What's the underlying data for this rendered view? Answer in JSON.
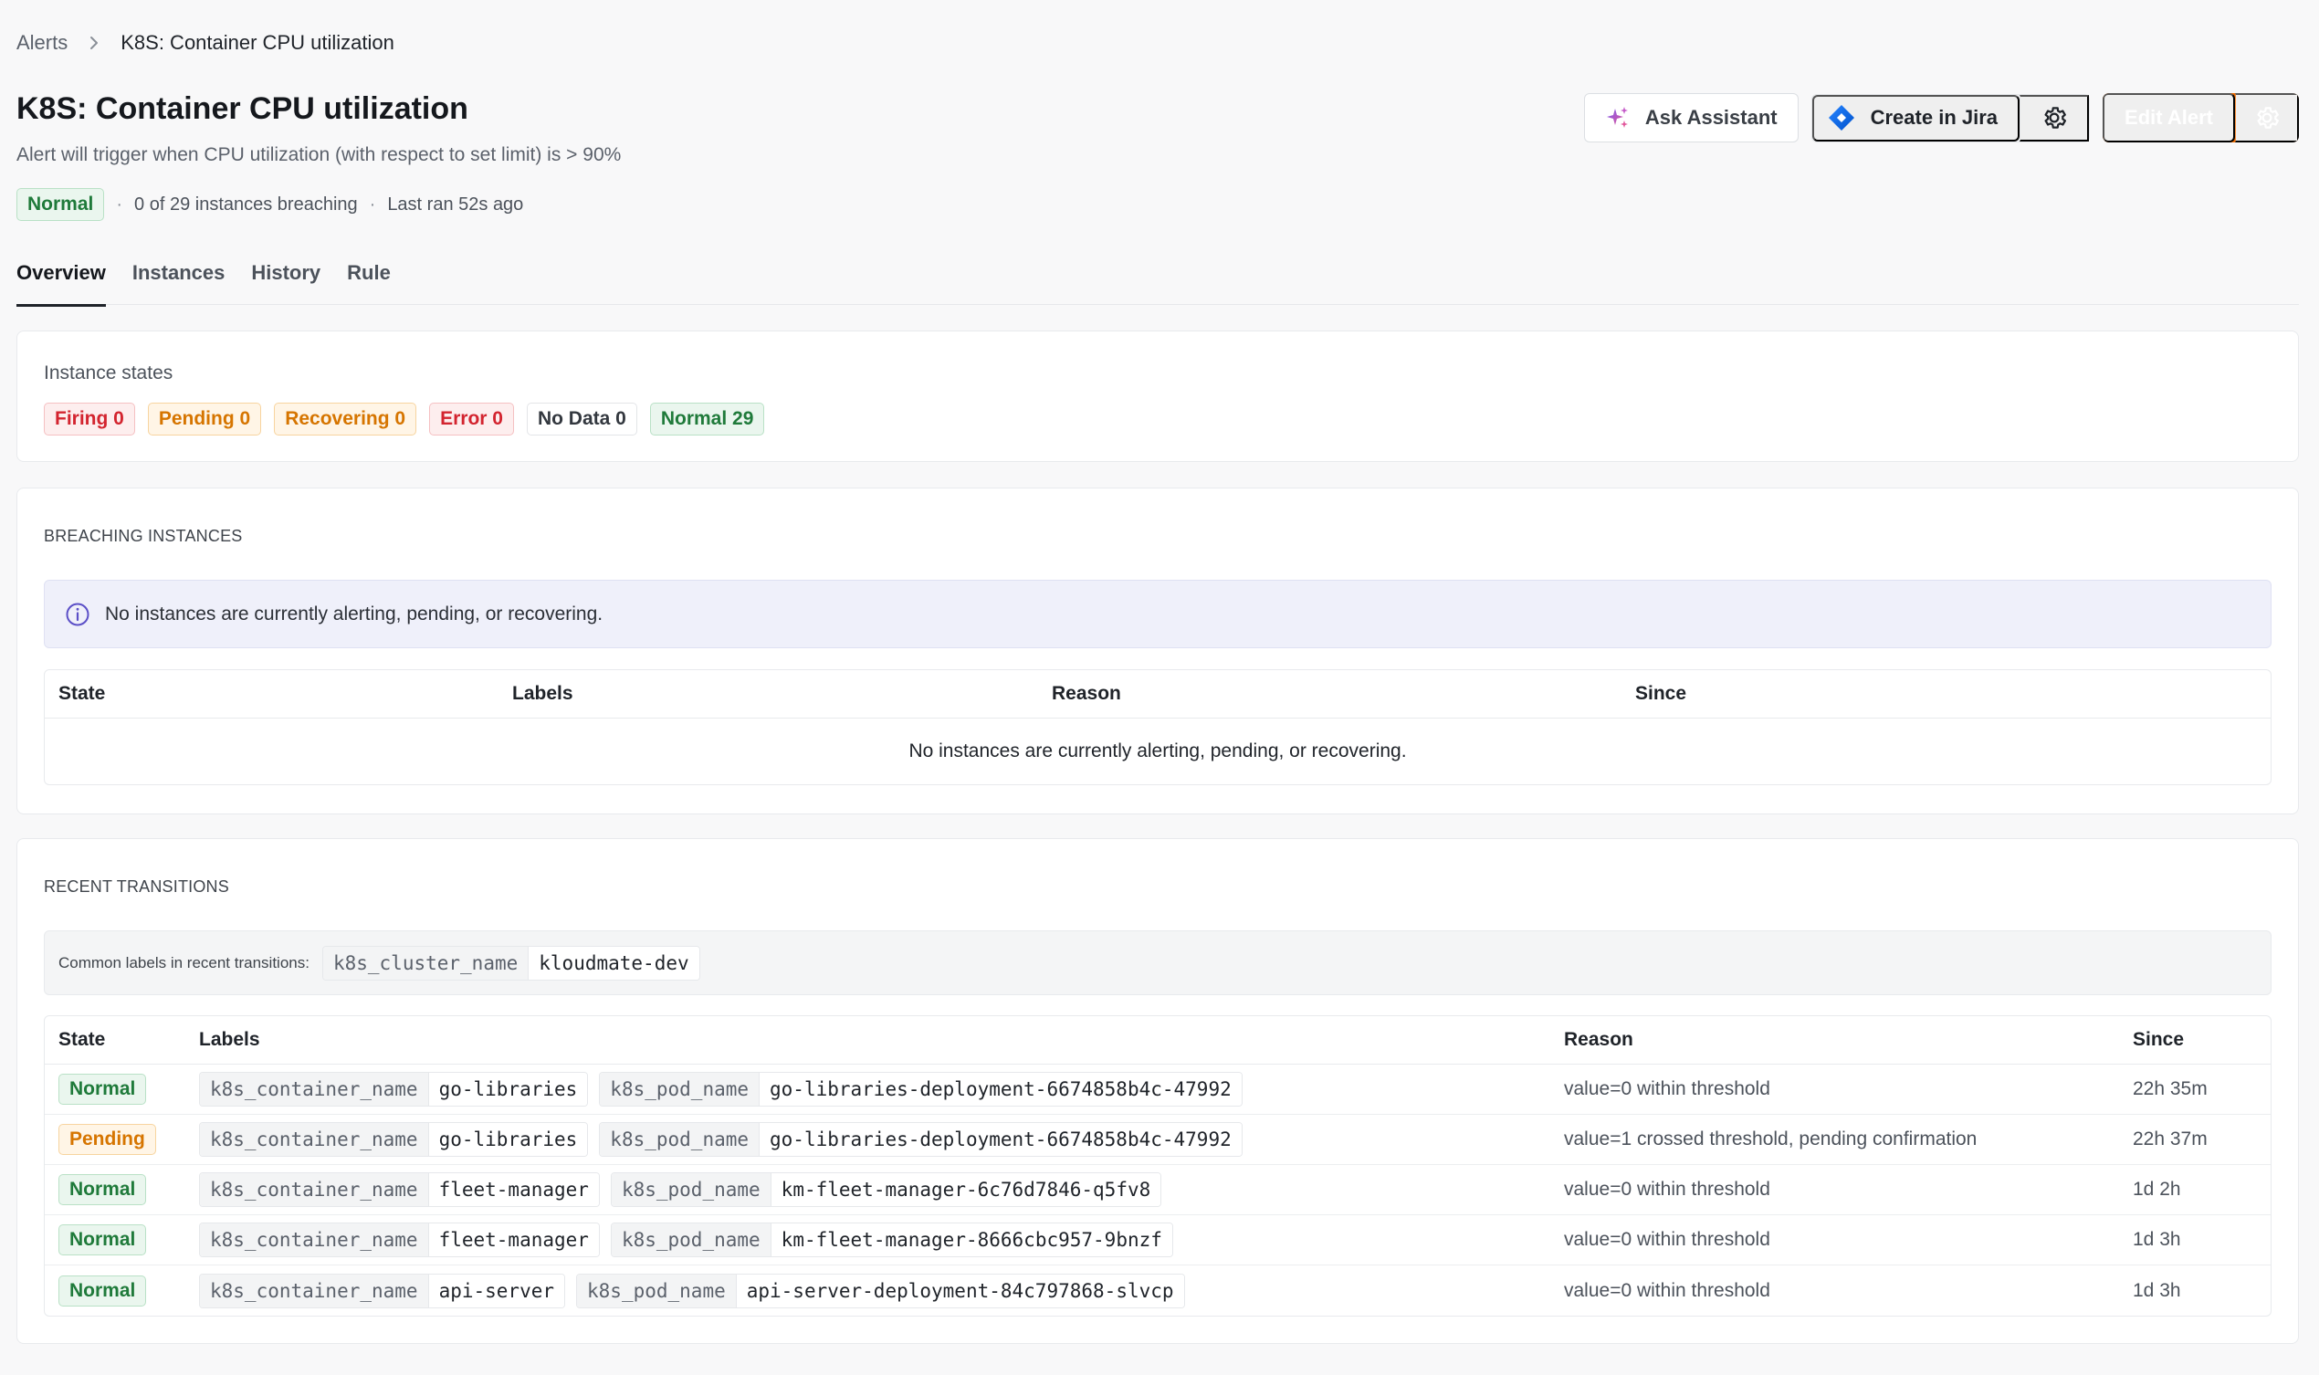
{
  "breadcrumb": {
    "root": "Alerts",
    "current": "K8S: Container CPU utilization"
  },
  "header": {
    "title": "K8S: Container CPU utilization",
    "description": "Alert will trigger when CPU utilization (with respect to set limit) is > 90%",
    "status": "Normal",
    "instances_breaching": "0 of 29 instances breaching",
    "last_ran": "Last ran 52s ago",
    "actions": {
      "ask_assistant": "Ask Assistant",
      "create_in_jira": "Create in Jira",
      "edit_alert": "Edit Alert"
    }
  },
  "tabs": [
    {
      "label": "Overview",
      "active": true
    },
    {
      "label": "Instances",
      "active": false
    },
    {
      "label": "History",
      "active": false
    },
    {
      "label": "Rule",
      "active": false
    }
  ],
  "instance_states": {
    "title": "Instance states",
    "items": [
      {
        "label": "Firing 0",
        "kind": "firing"
      },
      {
        "label": "Pending 0",
        "kind": "pending"
      },
      {
        "label": "Recovering 0",
        "kind": "recovering"
      },
      {
        "label": "Error 0",
        "kind": "error"
      },
      {
        "label": "No Data 0",
        "kind": "nodata"
      },
      {
        "label": "Normal 29",
        "kind": "normal"
      }
    ]
  },
  "breaching": {
    "title": "BREACHING INSTANCES",
    "banner": "No instances are currently alerting, pending, or recovering.",
    "columns": {
      "state": "State",
      "labels": "Labels",
      "reason": "Reason",
      "since": "Since"
    },
    "empty_text": "No instances are currently alerting, pending, or recovering."
  },
  "recent": {
    "title": "RECENT TRANSITIONS",
    "common_labels_text": "Common labels in recent transitions:",
    "common_label": {
      "key": "k8s_cluster_name",
      "value": "kloudmate-dev"
    },
    "columns": {
      "state": "State",
      "labels": "Labels",
      "reason": "Reason",
      "since": "Since"
    },
    "rows": [
      {
        "state": "Normal",
        "kind": "normal",
        "container_key": "k8s_container_name",
        "container": "go-libraries",
        "pod_key": "k8s_pod_name",
        "pod": "go-libraries-deployment-6674858b4c-47992",
        "reason": "value=0 within threshold",
        "since": "22h 35m"
      },
      {
        "state": "Pending",
        "kind": "pending",
        "container_key": "k8s_container_name",
        "container": "go-libraries",
        "pod_key": "k8s_pod_name",
        "pod": "go-libraries-deployment-6674858b4c-47992",
        "reason": "value=1 crossed threshold, pending confirmation",
        "since": "22h 37m"
      },
      {
        "state": "Normal",
        "kind": "normal",
        "container_key": "k8s_container_name",
        "container": "fleet-manager",
        "pod_key": "k8s_pod_name",
        "pod": "km-fleet-manager-6c76d7846-q5fv8",
        "reason": "value=0 within threshold",
        "since": "1d 2h"
      },
      {
        "state": "Normal",
        "kind": "normal",
        "container_key": "k8s_container_name",
        "container": "fleet-manager",
        "pod_key": "k8s_pod_name",
        "pod": "km-fleet-manager-8666cbc957-9bnzf",
        "reason": "value=0 within threshold",
        "since": "1d 3h"
      },
      {
        "state": "Normal",
        "kind": "normal",
        "container_key": "k8s_container_name",
        "container": "api-server",
        "pod_key": "k8s_pod_name",
        "pod": "api-server-deployment-84c797868-slvcp",
        "reason": "value=0 within threshold",
        "since": "1d 3h"
      }
    ]
  },
  "colors": {
    "accent": "#ef6c00",
    "normal": "#1f7a3a",
    "pending": "#d67500",
    "firing": "#d3242f",
    "info": "#5b4fc7"
  },
  "icons": {
    "breadcrumb_sep": "chevron-right-icon",
    "ask": "sparkle-icon",
    "jira": "jira-icon",
    "settings": "gear-icon",
    "info": "info-icon"
  }
}
